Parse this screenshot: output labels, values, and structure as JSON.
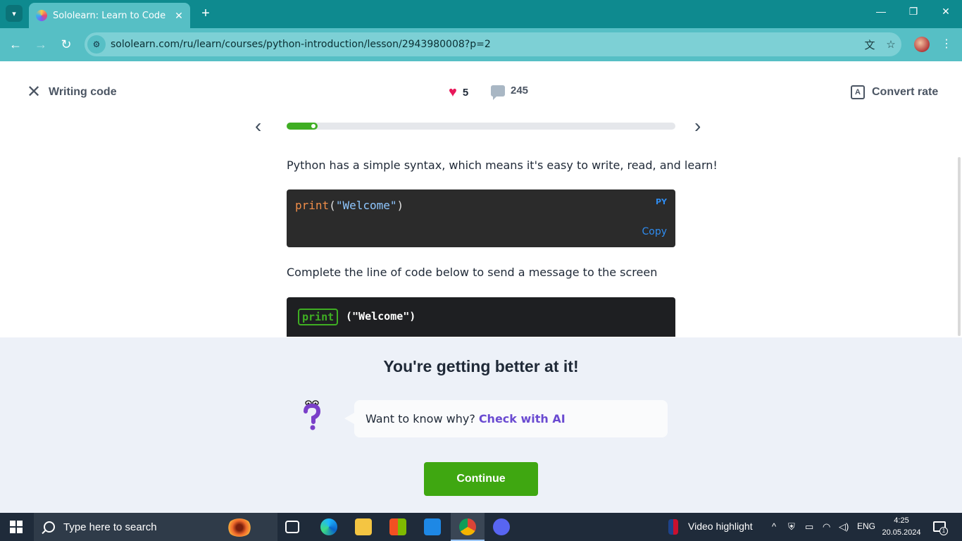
{
  "browser": {
    "tab_title": "Sololearn: Learn to Code",
    "url": "sololearn.com/ru/learn/courses/python-introduction/lesson/2943980008?p=2"
  },
  "header": {
    "lesson_title": "Writing code",
    "likes": "5",
    "comments": "245",
    "convert_label": "Convert rate"
  },
  "progress": {
    "fraction": 0.08
  },
  "lesson": {
    "intro": "Python has a simple syntax, which means it's easy to write, read, and learn!",
    "code_keyword": "print",
    "code_open": "(",
    "code_string": "\"Welcome\"",
    "code_close": ")",
    "code_lang": "PY",
    "copy_label": "Copy",
    "task": "Complete the line of code below to send a message to the screen",
    "answer_chip": "print",
    "answer_rest": "(\"Welcome\")"
  },
  "feedback": {
    "title": "You're getting better at it!",
    "question": "Want to know why?",
    "ai_link": "Check with AI",
    "continue_label": "Continue"
  },
  "taskbar": {
    "search_placeholder": "Type here to search",
    "news_label": "Video highlight",
    "language": "ENG",
    "time": "4:25",
    "date": "20.05.2024",
    "notification_count": "1"
  },
  "colors": {
    "brand_teal": "#0e8a8f",
    "accent_green": "#3fa711",
    "heart": "#e8185a",
    "ai_purple": "#6a4bd1"
  }
}
